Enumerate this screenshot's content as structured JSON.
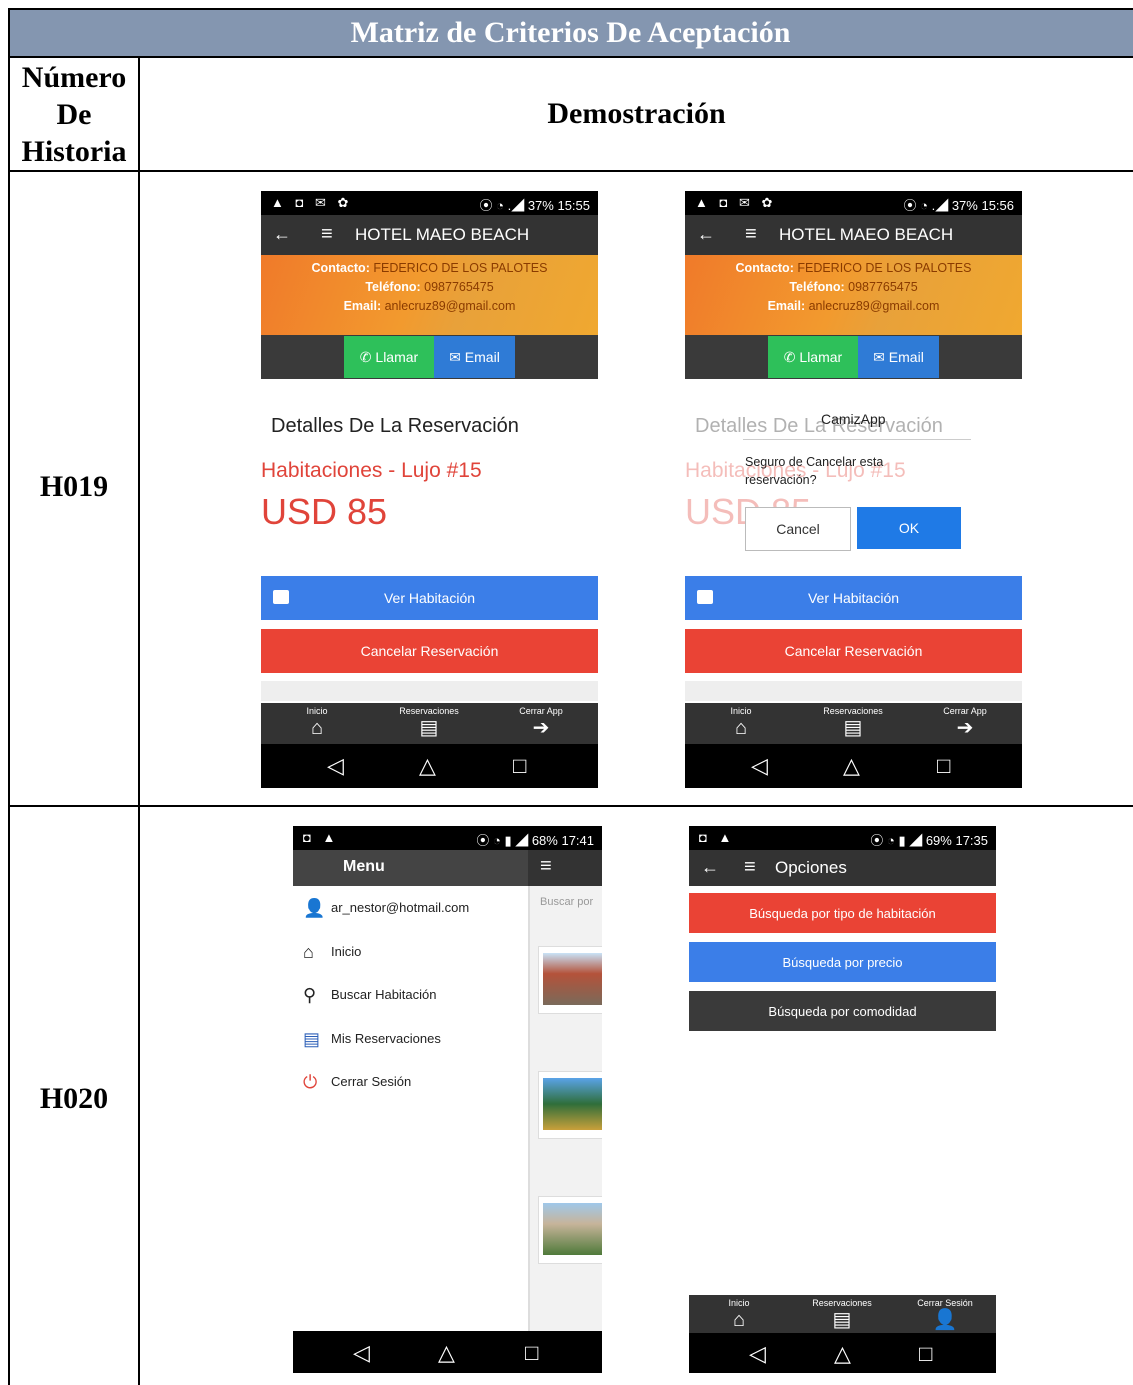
{
  "table": {
    "title": "Matriz de Criterios De Aceptación",
    "col_story": "Número De Historia",
    "col_demo": "Demostración",
    "rows": [
      {
        "id": "H019"
      },
      {
        "id": "H020"
      }
    ]
  },
  "hotel_screen": {
    "status_left": "▲ ◘ ✉ ✿",
    "status_right_a": "⦿ ◔ .◢ 37% 15:55",
    "status_right_b": "⦿ ◔ .◢ 37% 15:56",
    "title": "HOTEL MAEO BEACH",
    "contact_label": "Contacto:",
    "contact_value": "FEDERICO DE LOS PALOTES",
    "phone_label": "Teléfono:",
    "phone_value": "0987765475",
    "email_label": "Email:",
    "email_value": "anlecruz89@gmail.com",
    "call_btn": "Llamar",
    "email_btn": "Email",
    "details_heading": "Detalles De La Reservación",
    "room": "Habitaciones - Lujo #15",
    "price": "USD 85",
    "view_room": "Ver Habitación",
    "cancel_booking": "Cancelar Reservación",
    "tabs": [
      "Inicio",
      "Reservaciones",
      "Cerrar App"
    ],
    "dialog": {
      "title": "CamizApp",
      "message_1": "Seguro de Cancelar esta",
      "message_2": "reservación?",
      "cancel": "Cancel",
      "ok": "OK"
    }
  },
  "menu_screen": {
    "status_right": "⦿ ◔ ▮ ◢ 68% 17:41",
    "header": "Menu",
    "search_placeholder": "Buscar por",
    "items": [
      {
        "label": "ar_nestor@hotmail.com",
        "icon": "user-icon"
      },
      {
        "label": "Inicio",
        "icon": "home-icon"
      },
      {
        "label": "Buscar Habitación",
        "icon": "search-icon"
      },
      {
        "label": "Mis Reservaciones",
        "icon": "list-icon"
      },
      {
        "label": "Cerrar Sesión",
        "icon": "power-icon"
      }
    ]
  },
  "options_screen": {
    "status_right": "⦿ ◔ ▮ ◢ 69% 17:35",
    "title": "Opciones",
    "options": [
      "Búsqueda por tipo de habitación",
      "Búsqueda por precio",
      "Búsqueda por comodidad"
    ],
    "tabs": [
      "Inicio",
      "Reservaciones",
      "Cerrar Sesión"
    ]
  },
  "colors": {
    "header": "#8496b0",
    "red": "#ea4335",
    "blue": "#3b7ee8",
    "green": "#2ec05a",
    "dark": "#333333"
  }
}
